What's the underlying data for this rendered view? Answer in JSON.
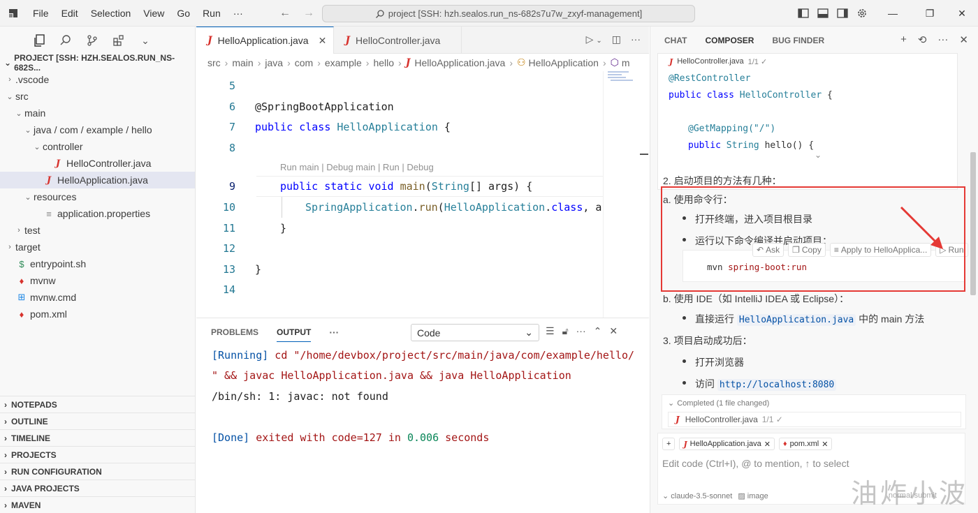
{
  "titlebar": {
    "menu": [
      "File",
      "Edit",
      "Selection",
      "View",
      "Go",
      "Run",
      "···"
    ],
    "search": "project [SSH: hzh.sealos.run_ns-682s7u7w_zxyf-management]",
    "win_minimize": "—",
    "win_restore": "❐",
    "win_close": "✕"
  },
  "sidebar": {
    "project_title": "PROJECT [SSH: HZH.SEALOS.RUN_NS-682S...",
    "tree": [
      {
        "label": ".vscode",
        "indent": 1,
        "chev": "›",
        "icon": ""
      },
      {
        "label": "src",
        "indent": 1,
        "chev": "⌄",
        "icon": ""
      },
      {
        "label": "main",
        "indent": 2,
        "chev": "⌄",
        "icon": ""
      },
      {
        "label": "java / com / example / hello",
        "indent": 3,
        "chev": "⌄",
        "icon": ""
      },
      {
        "label": "controller",
        "indent": 4,
        "chev": "⌄",
        "icon": ""
      },
      {
        "label": "HelloController.java",
        "indent": 5,
        "chev": "",
        "icon": "J"
      },
      {
        "label": "HelloApplication.java",
        "indent": 4,
        "chev": "",
        "icon": "J",
        "active": true
      },
      {
        "label": "resources",
        "indent": 3,
        "chev": "⌄",
        "icon": ""
      },
      {
        "label": "application.properties",
        "indent": 4,
        "chev": "",
        "icon": "≡"
      },
      {
        "label": "test",
        "indent": 2,
        "chev": "›",
        "icon": ""
      },
      {
        "label": "target",
        "indent": 1,
        "chev": "›",
        "icon": ""
      },
      {
        "label": "entrypoint.sh",
        "indent": 1,
        "chev": "",
        "icon": "$"
      },
      {
        "label": "mvnw",
        "indent": 1,
        "chev": "",
        "icon": "♦"
      },
      {
        "label": "mvnw.cmd",
        "indent": 1,
        "chev": "",
        "icon": "⊞"
      },
      {
        "label": "pom.xml",
        "indent": 1,
        "chev": "",
        "icon": "♦"
      }
    ],
    "sections": [
      "NOTEPADS",
      "OUTLINE",
      "TIMELINE",
      "PROJECTS",
      "RUN CONFIGURATION",
      "JAVA PROJECTS",
      "MAVEN"
    ]
  },
  "editor": {
    "tabs": [
      {
        "label": "HelloApplication.java",
        "active": true,
        "close": "✕"
      },
      {
        "label": "HelloController.java",
        "active": false
      }
    ],
    "breadcrumbs": [
      "src",
      "main",
      "java",
      "com",
      "example",
      "hello",
      "HelloApplication.java",
      "HelloApplication",
      "m"
    ],
    "codelens": "Run main | Debug main | Run | Debug",
    "lines": [
      {
        "n": "5"
      },
      {
        "n": "6"
      },
      {
        "n": "7"
      },
      {
        "n": "8"
      },
      {
        "n": "9"
      },
      {
        "n": "10"
      },
      {
        "n": "11"
      },
      {
        "n": "12"
      },
      {
        "n": "13"
      },
      {
        "n": "14"
      }
    ],
    "code": {
      "l6": "@SpringBootApplication",
      "l7_kw1": "public",
      "l7_kw2": "class",
      "l7_name": "HelloApplication",
      "l7_brace": " {",
      "l9_kw1": "public",
      "l9_kw2": "static",
      "l9_kw3": "void",
      "l9_fn": "main",
      "l9_rest1": "(",
      "l9_ty": "String",
      "l9_rest2": "[] args) {",
      "l10_ty": "SpringApplication",
      "l10_dot": ".",
      "l10_fn": "run",
      "l10_rest1": "(",
      "l10_ty2": "HelloApplication",
      "l10_dot2": ".",
      "l10_kw": "class",
      "l10_rest2": ", ar",
      "l11": "}",
      "l13": "}"
    }
  },
  "panel": {
    "tabs": [
      "PROBLEMS",
      "OUTPUT"
    ],
    "more": "···",
    "select_value": "Code",
    "output": {
      "l1_a": "[Running]",
      "l1_b": " cd \"/home/devbox/project/src/main/java/com/example/hello/",
      "l2": "\" && javac HelloApplication.java && java HelloApplication",
      "l3": "/bin/sh: 1: javac: not found",
      "l5_a": "[Done]",
      "l5_b": " exited with ",
      "l5_c": "code=127",
      "l5_d": " in ",
      "l5_e": "0.006",
      "l5_f": " seconds"
    }
  },
  "composer": {
    "tabs": [
      "CHAT",
      "COMPOSER",
      "BUG FINDER"
    ],
    "code_card": {
      "file": "HelloController.java",
      "count": "1/1 ✓",
      "l1": "@RestController",
      "l2_kw1": "public",
      "l2_kw2": "class",
      "l2_name": "HelloController",
      "l2_brace": " {",
      "l3": "@GetMapping(\"/\")",
      "l4_kw": "public",
      "l4_ty": "String",
      "l4_rest": " hello() {"
    },
    "md": {
      "p1": "2. 启动项目的方法有几种：",
      "a": "a. 使用命令行：",
      "a1": "打开终端，进入项目根目录",
      "a2": "运行以下命令编译并启动项目：",
      "cmd_a": "mvn",
      "cmd_b": " spring-boot:run",
      "b": "b. 使用 IDE（如 IntelliJ IDEA 或 Eclipse）：",
      "b1_pre": "直接运行 ",
      "b1_code": "HelloApplication.java",
      "b1_post": " 中的 main 方法",
      "p3": "3. 项目启动成功后：",
      "c1": "打开浏览器",
      "c2_pre": "访问 ",
      "c2_code": "http://localhost:8080"
    },
    "toolbar": {
      "ask": "Ask",
      "copy": "Copy",
      "apply": "Apply to HelloApplica...",
      "run": "Run"
    },
    "completed": {
      "label": "Completed (1 file changed)",
      "file": "HelloController.java",
      "count": "1/1 ✓"
    },
    "input": {
      "add": "+",
      "chip1": "HelloApplication.java",
      "chip2": "pom.xml",
      "placeholder": "Edit code (Ctrl+I), @ to mention, ↑ to select",
      "model": "claude-3.5-sonnet",
      "image": "image",
      "normal": "normal",
      "submit": "submit"
    }
  },
  "watermark": "油炸小波",
  "colors": {
    "accent": "#005fb8",
    "highlight": "#e53935",
    "java": "#d7322d"
  }
}
